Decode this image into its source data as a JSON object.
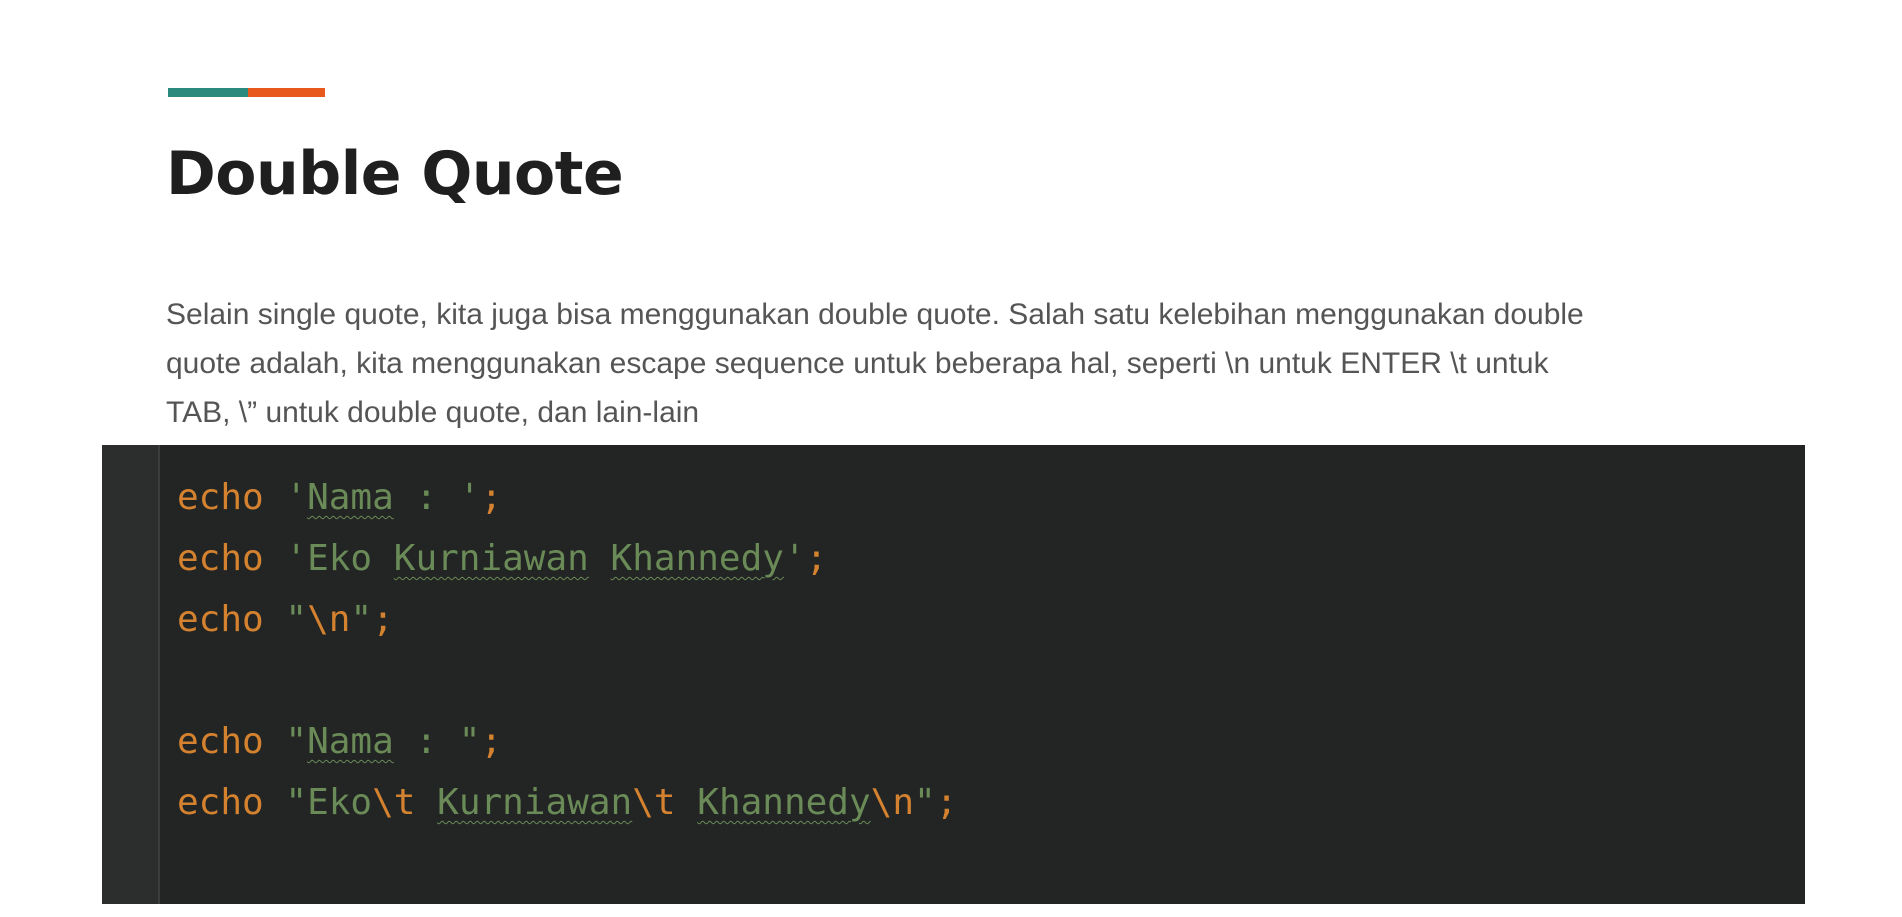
{
  "slide": {
    "title": "Double Quote",
    "accent_colors": [
      "#2a8a7e",
      "#e8581c"
    ],
    "description_lines": [
      "Selain single quote, kita juga bisa menggunakan double quote. Salah satu kelebihan menggunakan double",
      "quote adalah, kita menggunakan escape sequence untuk beberapa hal, seperti \\n untuk ENTER \\t untuk",
      "TAB, \\” untuk double quote, dan lain-lain"
    ]
  },
  "code": {
    "theme": {
      "background": "#222523",
      "keyword": "#d4822f",
      "string": "#6a8a57"
    },
    "lines": [
      [
        {
          "t": "echo",
          "c": "kw"
        },
        {
          "t": " "
        },
        {
          "t": "'",
          "c": "str"
        },
        {
          "t": "Nama",
          "c": "str sq"
        },
        {
          "t": " : '",
          "c": "str"
        },
        {
          "t": ";",
          "c": "semi"
        }
      ],
      [
        {
          "t": "echo",
          "c": "kw"
        },
        {
          "t": " "
        },
        {
          "t": "'Eko ",
          "c": "str"
        },
        {
          "t": "Kurniawan",
          "c": "str sq"
        },
        {
          "t": " ",
          "c": "str"
        },
        {
          "t": "Khannedy",
          "c": "str sq"
        },
        {
          "t": "'",
          "c": "str"
        },
        {
          "t": ";",
          "c": "semi"
        }
      ],
      [
        {
          "t": "echo",
          "c": "kw"
        },
        {
          "t": " "
        },
        {
          "t": "\"",
          "c": "str"
        },
        {
          "t": "\\n",
          "c": "esc"
        },
        {
          "t": "\"",
          "c": "str"
        },
        {
          "t": ";",
          "c": "semi"
        }
      ],
      [],
      [
        {
          "t": "echo",
          "c": "kw"
        },
        {
          "t": " "
        },
        {
          "t": "\"",
          "c": "str"
        },
        {
          "t": "Nama",
          "c": "str sq"
        },
        {
          "t": " : \"",
          "c": "str"
        },
        {
          "t": ";",
          "c": "semi"
        }
      ],
      [
        {
          "t": "echo",
          "c": "kw"
        },
        {
          "t": " "
        },
        {
          "t": "\"Eko",
          "c": "str"
        },
        {
          "t": "\\t",
          "c": "esc"
        },
        {
          "t": " ",
          "c": "str"
        },
        {
          "t": "Kurniawan",
          "c": "str sq"
        },
        {
          "t": "\\t",
          "c": "esc"
        },
        {
          "t": " ",
          "c": "str"
        },
        {
          "t": "Khannedy",
          "c": "str sq"
        },
        {
          "t": "\\n",
          "c": "esc"
        },
        {
          "t": "\"",
          "c": "str"
        },
        {
          "t": ";",
          "c": "semi"
        }
      ]
    ]
  }
}
